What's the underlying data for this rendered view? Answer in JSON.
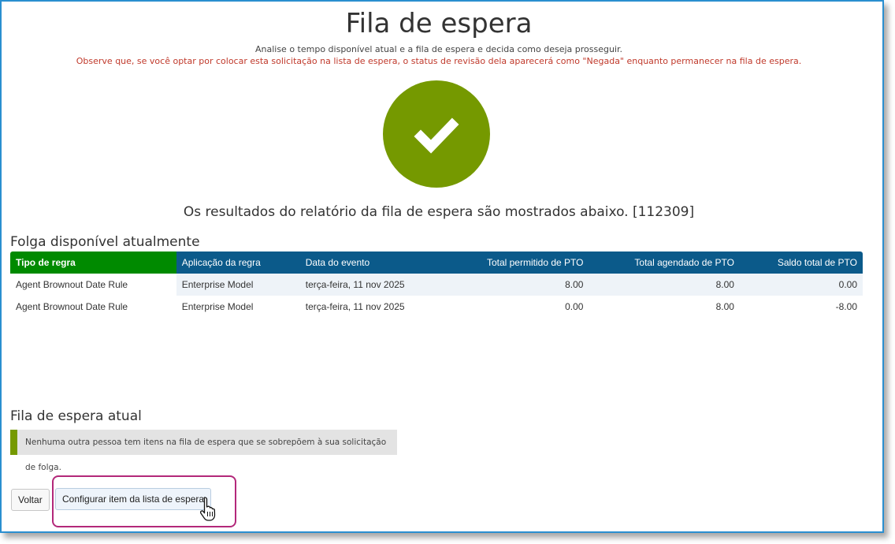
{
  "page": {
    "title": "Fila de espera",
    "subtitle": "Analise o tempo disponível atual e a fila de espera e decida como deseja prosseguir.",
    "warning": "Observe que, se você optar por colocar esta solicitação na lista de espera, o status de revisão dela aparecerá como \"Negada\" enquanto permanecer na fila de espera.",
    "results_text": "Os resultados do relatório da fila de espera são mostrados abaixo. [112309]",
    "icon": "check-icon",
    "accent_color": "#759900",
    "warning_color": "#c0392b"
  },
  "available": {
    "title": "Folga disponível atualmente",
    "headers": [
      "Tipo de regra",
      "Aplicação da regra",
      "Data do evento",
      "Total permitido de PTO",
      "Total agendado de PTO",
      "Saldo total de PTO"
    ],
    "rows": [
      [
        "Agent Brownout Date Rule",
        "Enterprise Model",
        "terça-feira, 11 nov 2025",
        "8.00",
        "8.00",
        "0.00"
      ],
      [
        "Agent Brownout Date Rule",
        "Enterprise Model",
        "terça-feira, 11 nov 2025",
        "0.00",
        "8.00",
        "-8.00"
      ]
    ]
  },
  "queue": {
    "title": "Fila de espera atual",
    "message": "Nenhuma outra pessoa tem itens na fila de espera que se sobrepõem à sua solicitação de folga."
  },
  "buttons": {
    "back": "Voltar",
    "configure": "Configurar item da lista de espera"
  }
}
